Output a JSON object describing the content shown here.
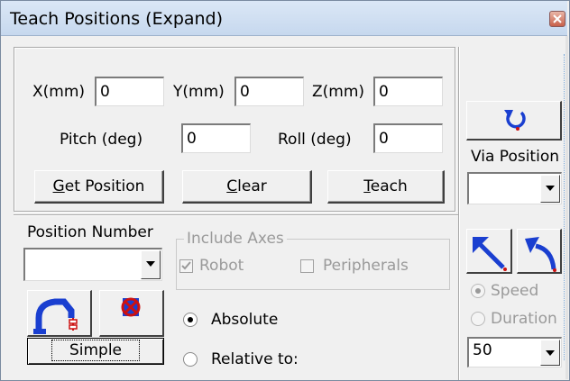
{
  "window": {
    "title": "Teach Positions (Expand)"
  },
  "coords": {
    "x_label": "X(mm)",
    "x_value": "0",
    "y_label": "Y(mm)",
    "y_value": "0",
    "z_label": "Z(mm)",
    "z_value": "0",
    "pitch_label": "Pitch (deg)",
    "pitch_value": "0",
    "roll_label": "Roll (deg)",
    "roll_value": "0"
  },
  "buttons": {
    "get_position": {
      "mn": "G",
      "rest": "et Position"
    },
    "clear": {
      "mn": "C",
      "rest": "lear"
    },
    "teach": {
      "mn": "T",
      "rest": "each"
    },
    "simple": "Simple"
  },
  "via": {
    "label": "Via Position",
    "value": ""
  },
  "position_number": {
    "label": "Position Number",
    "value": ""
  },
  "include_axes": {
    "legend": "Include Axes",
    "robot_label": "Robot",
    "robot_checked": true,
    "peripherals_label": "Peripherals",
    "peripherals_checked": false
  },
  "mode": {
    "absolute_label": "Absolute",
    "relative_label": "Relative to:",
    "selected": "absolute"
  },
  "motion": {
    "speed_label": "Speed",
    "duration_label": "Duration",
    "selected": "speed",
    "speed_value": "50"
  },
  "icons": {
    "rotate": "rotate-arrow-icon",
    "robot": "robot-arm-icon",
    "stop": "cancel-robot-icon",
    "line_move": "linear-move-icon",
    "joint_move": "joint-move-icon"
  },
  "colors": {
    "title_bar": "#c6d8ee",
    "icon_blue": "#1a3fd0",
    "icon_red": "#cc1111"
  }
}
